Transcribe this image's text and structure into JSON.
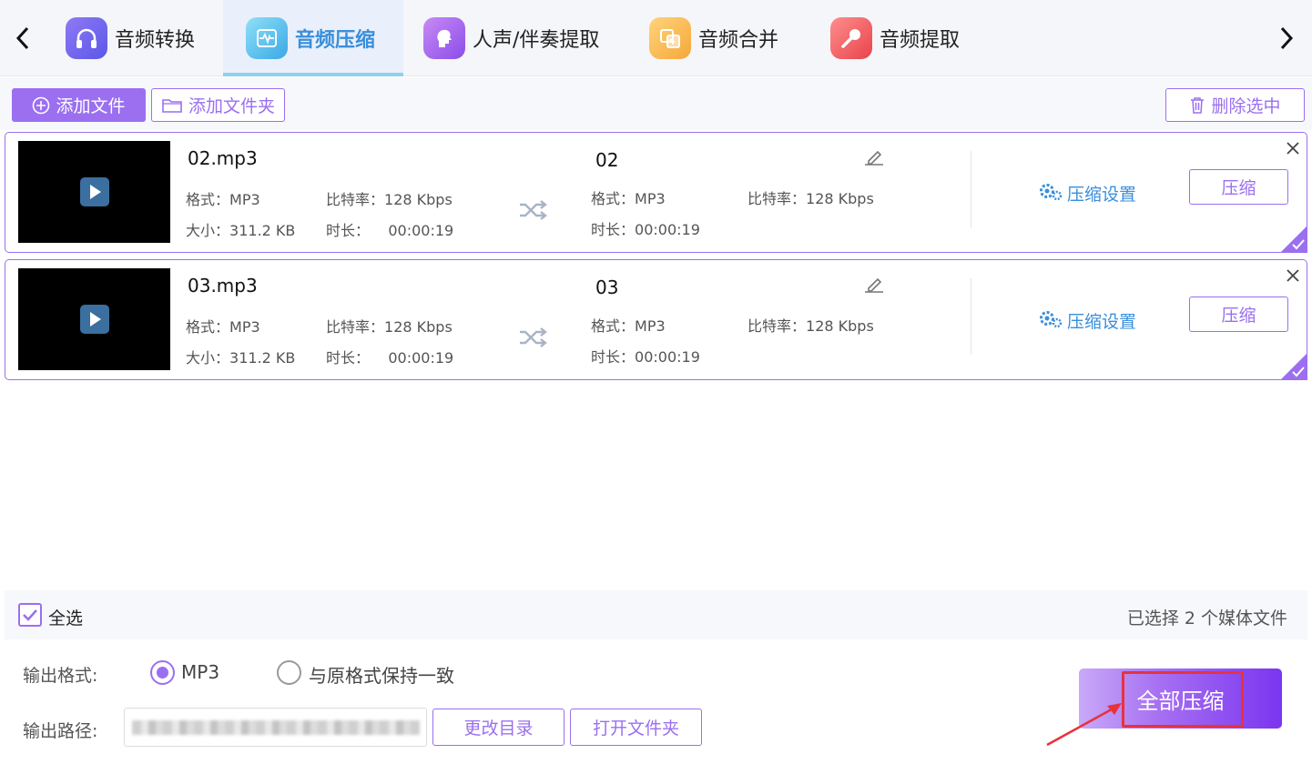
{
  "tabs": [
    {
      "label": "音频转换",
      "icon": "headphones-icon",
      "active": false
    },
    {
      "label": "音频压缩",
      "icon": "waveform-icon",
      "active": true
    },
    {
      "label": "人声/伴奏提取",
      "icon": "voice-icon",
      "active": false
    },
    {
      "label": "音频合并",
      "icon": "merge-icon",
      "active": false
    },
    {
      "label": "音频提取",
      "icon": "microphone-icon",
      "active": false
    }
  ],
  "toolbar": {
    "add_file": "添加文件",
    "add_folder": "添加文件夹",
    "delete_selected": "删除选中"
  },
  "files": [
    {
      "name": "02.mp3",
      "format_label": "格式：",
      "format": "MP3",
      "bitrate_label": "比特率：",
      "bitrate": "128 Kbps",
      "size_label": "大小：",
      "size": "311.2 KB",
      "duration_label": "时长：",
      "duration": "00:00:19",
      "output_name": "02",
      "out_format": "MP3",
      "out_bitrate": "128 Kbps",
      "out_duration": "00:00:19",
      "settings": "压缩设置",
      "compress": "压缩"
    },
    {
      "name": "03.mp3",
      "format_label": "格式：",
      "format": "MP3",
      "bitrate_label": "比特率：",
      "bitrate": "128 Kbps",
      "size_label": "大小：",
      "size": "311.2 KB",
      "duration_label": "时长：",
      "duration": "00:00:19",
      "output_name": "03",
      "out_format": "MP3",
      "out_bitrate": "128 Kbps",
      "out_duration": "00:00:19",
      "settings": "压缩设置",
      "compress": "压缩"
    }
  ],
  "selection": {
    "select_all": "全选",
    "count_text": "已选择 2 个媒体文件"
  },
  "output": {
    "format_label": "输出格式:",
    "option_mp3": "MP3",
    "option_same": "与原格式保持一致",
    "path_label": "输出路径:",
    "change_dir": "更改目录",
    "open_folder": "打开文件夹",
    "compress_all": "全部压缩"
  },
  "colors": {
    "accent": "#9b6ff0",
    "link": "#3a8fdb",
    "annotation": "#e8323c"
  }
}
